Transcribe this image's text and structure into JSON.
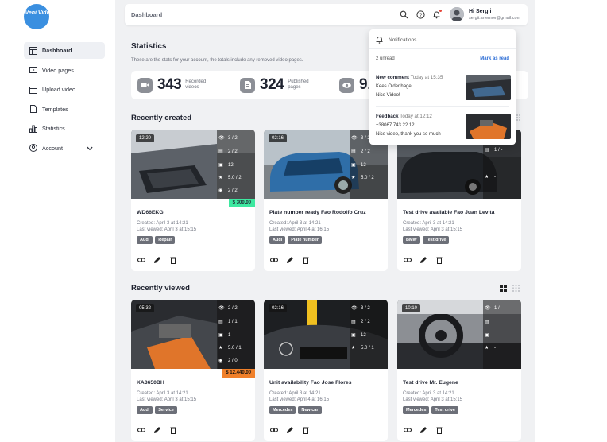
{
  "app": {
    "logo_text": "Veni Vidi"
  },
  "sidebar": {
    "items": [
      {
        "label": "Dashboard",
        "icon": "dashboard-icon",
        "active": true
      },
      {
        "label": "Video pages",
        "icon": "video-page-icon"
      },
      {
        "label": "Upload video",
        "icon": "upload-video-icon"
      },
      {
        "label": "Templates",
        "icon": "template-icon"
      },
      {
        "label": "Statistics",
        "icon": "statistics-icon"
      },
      {
        "label": "Account",
        "icon": "account-icon",
        "has_chevron": true
      }
    ]
  },
  "topbar": {
    "title": "Dashboard",
    "user_greeting": "Hi Sergii",
    "user_email": "sergii.artemov@gmail.com"
  },
  "stats": {
    "title": "Statistics",
    "subtitle": "These are the stats for your account, the totals include any removed video pages.",
    "items": [
      {
        "value": "343",
        "label": "Recorded videos",
        "icon": "video-icon"
      },
      {
        "value": "324",
        "label": "Published pages",
        "icon": "page-icon"
      },
      {
        "value": "9,",
        "label": "",
        "icon": "eye-icon"
      }
    ]
  },
  "sections": {
    "recently_created": "Recently created",
    "recently_viewed": "Recently viewed"
  },
  "created_cards": [
    {
      "duration": "12:20",
      "views": "3 / 2",
      "comments": "2 / 2",
      "messages": "12",
      "rating": "5.0 / 2",
      "checks": "2 / 2",
      "price": "$ 300,00",
      "price_color": "#3de8a0",
      "title": "WD66EKG",
      "created": "Created: April 3 at 14:21",
      "viewed": "Last viewed:  April 3 at 15:15",
      "tags": [
        "Audi",
        "Repair"
      ]
    },
    {
      "duration": "02:16",
      "views": "3 / 2",
      "comments": "2 / 2",
      "messages": "12",
      "rating": "5.0 / 2",
      "title": "Plate number ready Fao Rodolfo Cruz",
      "created": "Created: April 3 at 14:21",
      "viewed": "Last viewed:  April 4 at 16:15",
      "tags": [
        "Audi",
        "Plate number"
      ]
    },
    {
      "duration": "",
      "views": "1 / -",
      "comments": "",
      "messages": "",
      "rating": "-",
      "title": "Test drive available Fao Juan Levita",
      "created": "Created: April 3 at 14:21",
      "viewed": "Last viewed:  April 3 at 15:15",
      "tags": [
        "BMW",
        "Test drive"
      ]
    }
  ],
  "viewed_cards": [
    {
      "duration": "05:32",
      "views": "2 / 2",
      "comments": "1 / 1",
      "messages": "1",
      "rating": "5.0 / 1",
      "checks": "2 / 0",
      "price": "$ 12.440,00",
      "price_color": "#f0802a",
      "title": "KA3650BH",
      "created": "Created: April 3 at 14:21",
      "viewed": "Last viewed:  April 3 at 15:15",
      "tags": [
        "Audi",
        "Service"
      ]
    },
    {
      "duration": "02:16",
      "views": "3 / 2",
      "comments": "2 / 2",
      "messages": "12",
      "rating": "5.0 / 1",
      "title": "Unit availability Fao Jose Flores",
      "created": "Created: April 3 at 14:21",
      "viewed": "Last viewed:  April 4 at 16:15",
      "tags": [
        "Mercedes",
        "New car"
      ]
    },
    {
      "duration": "10:10",
      "views": "1 / -",
      "comments": "",
      "messages": "",
      "rating": "-",
      "title": "Test drive Mr. Eugene",
      "created": "Created: April 3 at 14:21",
      "viewed": "Last viewed:  April 3 at 15:15",
      "tags": [
        "Mercedes",
        "Test drive"
      ]
    }
  ],
  "notifications": {
    "title": "Notifications",
    "unread": "2 unread",
    "mark_as_read": "Mark as read",
    "items": [
      {
        "type": "New comment",
        "time": "Today at 15:35",
        "line1": "Kees Oldenhage",
        "line2": "Nice Video!"
      },
      {
        "type": "Feedback",
        "time": "Today at 12:12",
        "line1": "+38067 743 22 12",
        "line2": "Nice video, thank you so much"
      }
    ]
  },
  "colors": {
    "accent_blue": "#2f6fd6",
    "price_green": "#3de8a0",
    "price_orange": "#f0802a",
    "logo_blue": "#3a8fe0"
  }
}
